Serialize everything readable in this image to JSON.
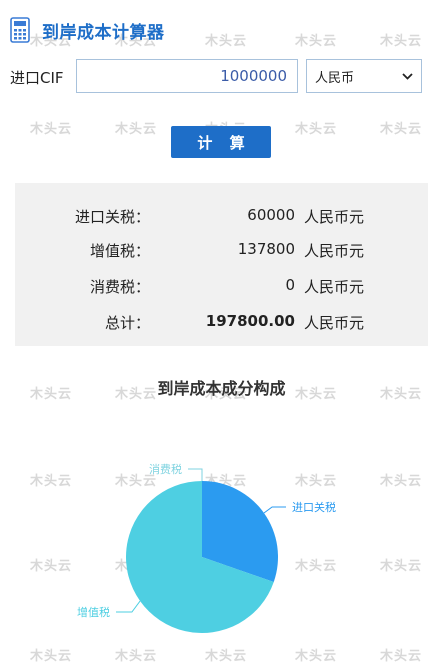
{
  "header": {
    "title": "到岸成本计算器",
    "icon": "calculator-icon"
  },
  "form": {
    "cif_label": "进口CIF",
    "cif_value": "1000000",
    "currency_selected": "人民币",
    "calculate_label": "计 算"
  },
  "results": [
    {
      "label": "进口关税：",
      "value": "60000",
      "unit": "人民币元",
      "bold": false
    },
    {
      "label": "增值税：",
      "value": "137800",
      "unit": "人民币元",
      "bold": false
    },
    {
      "label": "消费税：",
      "value": "0",
      "unit": "人民币元",
      "bold": false
    },
    {
      "label": "总计：",
      "value": "197800.00",
      "unit": "人民币元",
      "bold": true
    }
  ],
  "watermark_text": "木头云",
  "chart_data": {
    "type": "pie",
    "title": "到岸成本成分构成",
    "slices": [
      {
        "name": "进口关税",
        "value": 60000,
        "color": "#2b9bf0"
      },
      {
        "name": "增值税",
        "value": 137800,
        "color": "#4ecfe2"
      },
      {
        "name": "消费税",
        "value": 0,
        "color": "#7fd3e0"
      }
    ]
  }
}
